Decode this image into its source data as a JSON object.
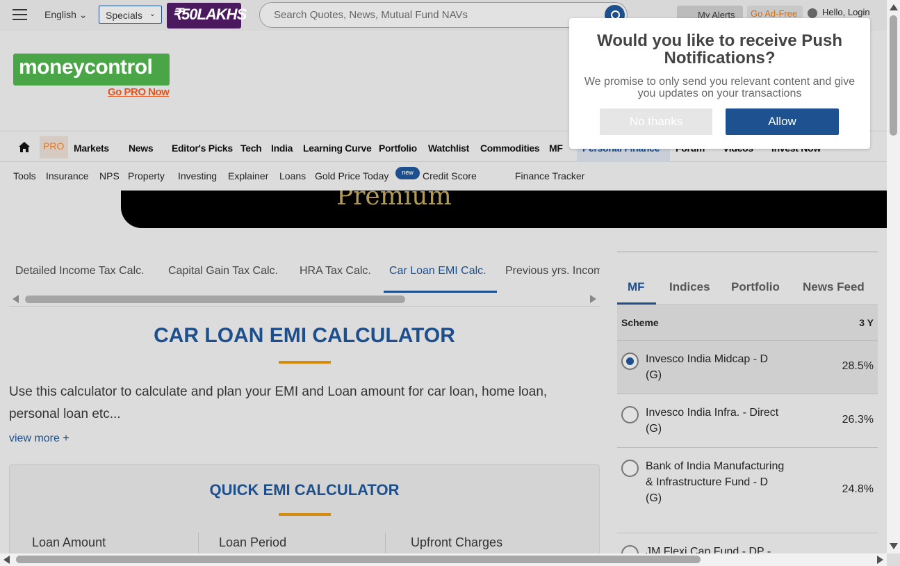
{
  "header": {
    "language": "English",
    "specials": "Specials",
    "lakhs_badge": "₹50LAKHS",
    "search_placeholder": "Search Quotes, News, Mutual Fund NAVs",
    "alerts": "My Alerts",
    "adfree": "Go Ad-Free",
    "login": "Hello, Login"
  },
  "logo": {
    "text_money": "money",
    "text_control": "control",
    "gopro": "Go PRO Now"
  },
  "nav": {
    "pro": "PRO",
    "items": [
      "Markets",
      "News",
      "Editor's Picks",
      "Tech",
      "India",
      "Learning Curve",
      "Portfolio",
      "Watchlist",
      "Commodities",
      "MF",
      "Personal Finance",
      "Forum",
      "Videos",
      "Invest Now"
    ]
  },
  "subnav": {
    "items": [
      "Tools",
      "Insurance",
      "NPS",
      "Property",
      "Investing",
      "Explainer",
      "Loans",
      "Gold Price Today",
      "Credit Score",
      "Finance Tracker"
    ],
    "new_badge": "new"
  },
  "banner": {
    "text": "Premium"
  },
  "calc_tabs": [
    "Detailed Income Tax Calc.",
    "Capital Gain Tax Calc.",
    "HRA Tax Calc.",
    "Car Loan EMI Calc.",
    "Previous yrs. Income Tax Calc."
  ],
  "page": {
    "title": "CAR LOAN EMI CALCULATOR",
    "description": "Use this calculator to calculate and plan your EMI and Loan amount for car loan, home loan, personal loan etc...",
    "view_more": "view more +"
  },
  "quick": {
    "title": "QUICK EMI CALCULATOR",
    "fields": [
      "Loan Amount",
      "Loan Period",
      "Upfront Charges"
    ]
  },
  "right_panel": {
    "tabs": [
      "MF",
      "Indices",
      "Portfolio",
      "News Feed"
    ],
    "head_scheme": "Scheme",
    "head_period": "3 Y",
    "funds": [
      {
        "name": "Invesco India Midcap - D (G)",
        "ret": "28.5%"
      },
      {
        "name": "Invesco India Infra. - Direct (G)",
        "ret": "26.3%"
      },
      {
        "name": "Bank of India Manufacturing & Infrastructure Fund - D (G)",
        "ret": "24.8%"
      },
      {
        "name": "JM Flexi Cap Fund - DP -",
        "ret": ""
      }
    ]
  },
  "push": {
    "title": "Would you like to receive Push Notifications?",
    "desc": "We promise to only send you relevant content and give you updates on your transactions",
    "no": "No thanks",
    "yes": "Allow"
  }
}
